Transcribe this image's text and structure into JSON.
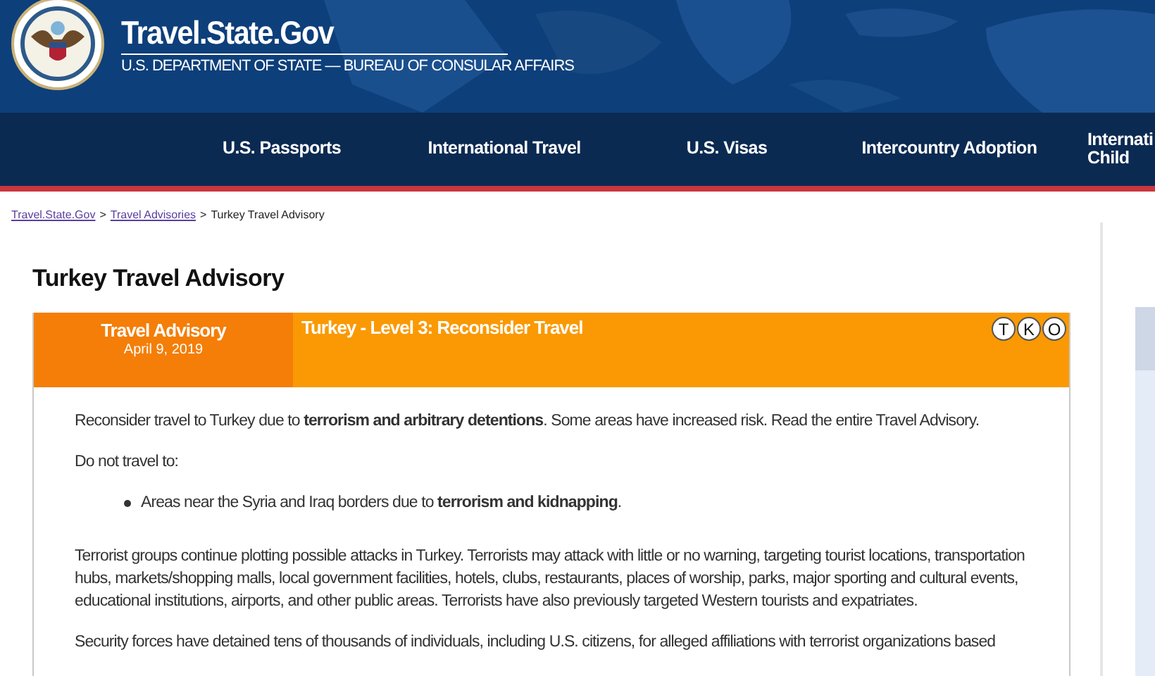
{
  "site": {
    "title": "Travel.State.Gov",
    "subtitle": "U.S. DEPARTMENT OF STATE — BUREAU OF CONSULAR AFFAIRS"
  },
  "nav": [
    {
      "label": "U.S. Passports"
    },
    {
      "label": "International Travel"
    },
    {
      "label": "U.S. Visas"
    },
    {
      "label": "Intercountry Adoption"
    },
    {
      "label": "Internati\nChild"
    }
  ],
  "breadcrumb": [
    {
      "label": "Travel.State.Gov",
      "kind": "link"
    },
    {
      "label": ">",
      "kind": "separator"
    },
    {
      "label": "Travel Advisories",
      "kind": "link"
    },
    {
      "label": ">",
      "kind": "separator"
    },
    {
      "label": "Turkey Travel Advisory",
      "kind": "current"
    }
  ],
  "page_title": "Turkey Travel Advisory",
  "advisory": {
    "badge_title": "Travel Advisory",
    "date": "April 9, 2019",
    "level_title": "Turkey - Level 3: Reconsider Travel",
    "indicators": [
      "T",
      "K",
      "O"
    ],
    "body": [
      {
        "kind": "paragraph",
        "text": "Reconsider travel to Turkey due to **terrorism and arbitrary detentions**. Some areas have increased risk. Read the entire Travel Advisory."
      },
      {
        "kind": "paragraph",
        "text": "Do not travel to:"
      },
      {
        "kind": "bullet",
        "text": "Areas near the Syria and Iraq borders due to **terrorism and kidnapping**."
      },
      {
        "kind": "paragraph",
        "text": "Terrorist groups continue plotting possible attacks in Turkey. Terrorists may attack with little or no warning, targeting tourist locations, transportation hubs, markets/shopping malls, local government facilities, hotels, clubs, restaurants, places of worship, parks, major sporting and cultural events, educational institutions, airports, and other public areas. Terrorists have also previously targeted Western tourists and expatriates."
      },
      {
        "kind": "cutline",
        "text": "Security forces have detained tens of thousands of individuals, including U.S. citizens, for alleged affiliations with terrorist organizations based"
      }
    ]
  }
}
